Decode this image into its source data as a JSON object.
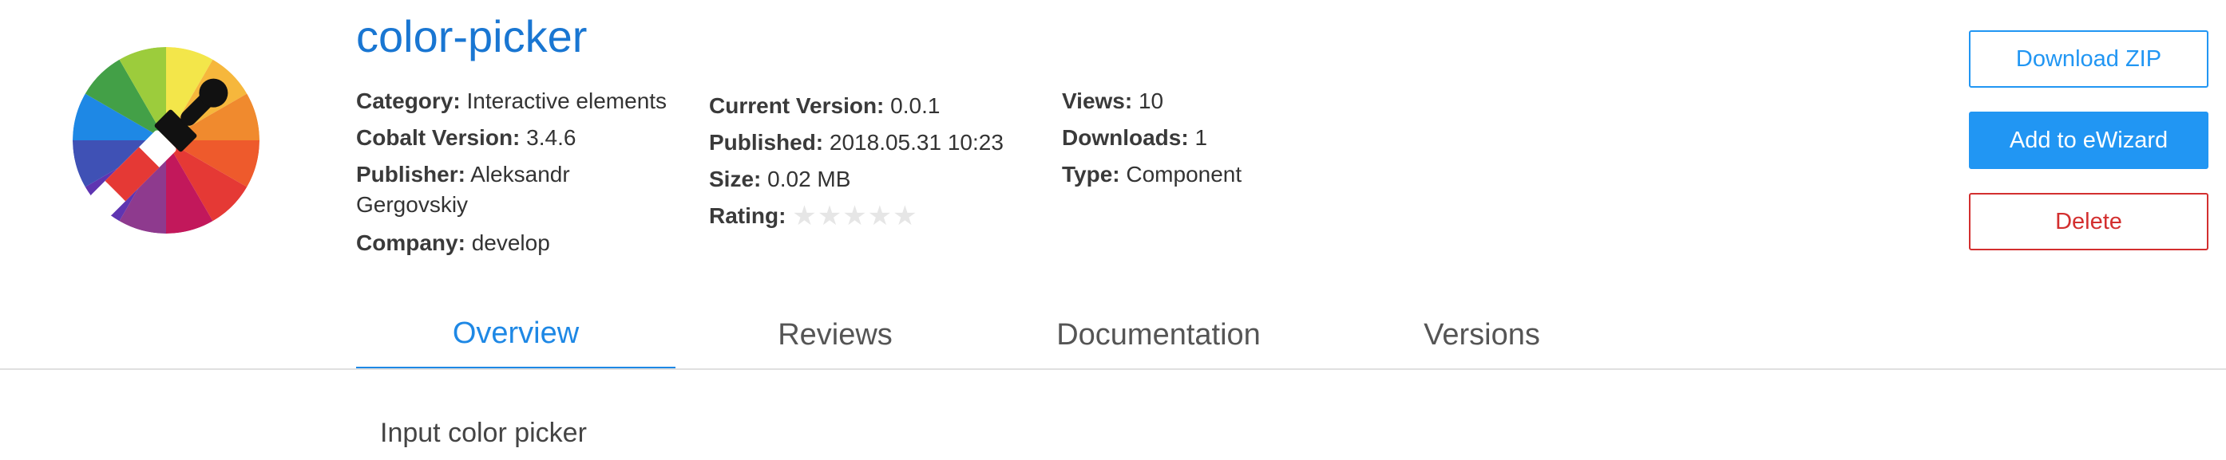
{
  "component": {
    "title": "color-picker",
    "icon": "color-wheel-with-eyedropper"
  },
  "meta_left": [
    {
      "key": "Category:",
      "value": "Interactive elements"
    },
    {
      "key": "Cobalt Version:",
      "value": "3.4.6"
    },
    {
      "key": "Publisher:",
      "value": "Aleksandr Gergovskiy"
    },
    {
      "key": "Company:",
      "value": "develop"
    }
  ],
  "meta_mid": [
    {
      "key": "Current Version:",
      "value": "0.0.1"
    },
    {
      "key": "Published:",
      "value": "2018.05.31 10:23"
    },
    {
      "key": "Size:",
      "value": "0.02 MB"
    },
    {
      "key": "Rating:",
      "value": "0"
    }
  ],
  "meta_right": [
    {
      "key": "Views:",
      "value": "10"
    },
    {
      "key": "Downloads:",
      "value": "1"
    },
    {
      "key": "Type:",
      "value": "Component"
    }
  ],
  "rating": {
    "stars": 0,
    "max": 5,
    "empty_color": "#e6e6e6"
  },
  "actions": {
    "download": "Download ZIP",
    "add": "Add to eWizard",
    "delete": "Delete"
  },
  "tabs": [
    {
      "label": "Overview",
      "active": true
    },
    {
      "label": "Reviews",
      "active": false
    },
    {
      "label": "Documentation",
      "active": false
    },
    {
      "label": "Versions",
      "active": false
    }
  ],
  "overview": {
    "text": "Input color picker"
  },
  "colors": {
    "accent": "#1e88e5",
    "primary_button": "#2196f3",
    "danger": "#d32f2f"
  }
}
